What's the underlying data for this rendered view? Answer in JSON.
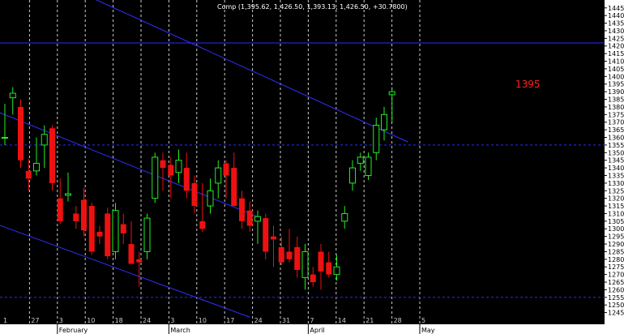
{
  "chart_data": {
    "type": "candlestick",
    "title": "Comp (1,395.62, 1,426.50, 1,393.13, 1,426.50, +30.7800)",
    "annotation": "1395",
    "ylim": [
      1240,
      1447
    ],
    "y_ticks": [
      1245,
      1250,
      1255,
      1260,
      1265,
      1270,
      1275,
      1280,
      1285,
      1290,
      1295,
      1300,
      1305,
      1310,
      1315,
      1320,
      1325,
      1330,
      1335,
      1340,
      1345,
      1350,
      1355,
      1360,
      1365,
      1370,
      1375,
      1380,
      1385,
      1390,
      1395,
      1400,
      1405,
      1410,
      1415,
      1420,
      1425,
      1430,
      1435,
      1440,
      1445
    ],
    "x_ticks": [
      "1",
      "27",
      "3",
      "10",
      "18",
      "24",
      "3",
      "10",
      "17",
      "24",
      "31",
      "7",
      "14",
      "21",
      "28",
      "5"
    ],
    "month_labels": [
      "February",
      "March",
      "April",
      "May"
    ],
    "horizontal_lines": [
      1422,
      1355,
      1255
    ],
    "trend_lines": [
      {
        "from": [
          -1,
          1480
        ],
        "to": [
          51,
          1357
        ]
      },
      {
        "from": [
          -1,
          1377
        ],
        "to": [
          32,
          1308
        ]
      },
      {
        "from": [
          -1,
          1303
        ],
        "to": [
          31,
          1242
        ]
      }
    ],
    "candles": [
      {
        "o": 1360,
        "h": 1382,
        "l": 1355,
        "c": 1360
      },
      {
        "o": 1386,
        "h": 1393,
        "l": 1375,
        "c": 1389
      },
      {
        "o": 1380,
        "h": 1385,
        "l": 1340,
        "c": 1345
      },
      {
        "o": 1338,
        "h": 1346,
        "l": 1325,
        "c": 1333
      },
      {
        "o": 1338,
        "h": 1360,
        "l": 1335,
        "c": 1343
      },
      {
        "o": 1355,
        "h": 1368,
        "l": 1340,
        "c": 1362
      },
      {
        "o": 1366,
        "h": 1368,
        "l": 1325,
        "c": 1330
      },
      {
        "o": 1320,
        "h": 1333,
        "l": 1303,
        "c": 1305
      },
      {
        "o": 1322,
        "h": 1337,
        "l": 1318,
        "c": 1323
      },
      {
        "o": 1310,
        "h": 1315,
        "l": 1300,
        "c": 1305
      },
      {
        "o": 1319,
        "h": 1327,
        "l": 1295,
        "c": 1299
      },
      {
        "o": 1315,
        "h": 1317,
        "l": 1283,
        "c": 1285
      },
      {
        "o": 1298,
        "h": 1302,
        "l": 1290,
        "c": 1295
      },
      {
        "o": 1310,
        "h": 1314,
        "l": 1280,
        "c": 1282
      },
      {
        "o": 1285,
        "h": 1317,
        "l": 1280,
        "c": 1312
      },
      {
        "o": 1303,
        "h": 1310,
        "l": 1290,
        "c": 1297
      },
      {
        "o": 1290,
        "h": 1305,
        "l": 1280,
        "c": 1277
      },
      {
        "o": 1280,
        "h": 1285,
        "l": 1262,
        "c": 1278
      },
      {
        "o": 1285,
        "h": 1310,
        "l": 1280,
        "c": 1307
      },
      {
        "o": 1320,
        "h": 1350,
        "l": 1317,
        "c": 1347
      },
      {
        "o": 1345,
        "h": 1350,
        "l": 1325,
        "c": 1340
      },
      {
        "o": 1342,
        "h": 1347,
        "l": 1320,
        "c": 1335
      },
      {
        "o": 1337,
        "h": 1352,
        "l": 1330,
        "c": 1345
      },
      {
        "o": 1340,
        "h": 1350,
        "l": 1320,
        "c": 1325
      },
      {
        "o": 1330,
        "h": 1335,
        "l": 1310,
        "c": 1315
      },
      {
        "o": 1305,
        "h": 1330,
        "l": 1298,
        "c": 1300
      },
      {
        "o": 1315,
        "h": 1333,
        "l": 1310,
        "c": 1325
      },
      {
        "o": 1330,
        "h": 1345,
        "l": 1320,
        "c": 1340
      },
      {
        "o": 1343,
        "h": 1345,
        "l": 1320,
        "c": 1335
      },
      {
        "o": 1340,
        "h": 1350,
        "l": 1315,
        "c": 1315
      },
      {
        "o": 1320,
        "h": 1325,
        "l": 1300,
        "c": 1305
      },
      {
        "o": 1312,
        "h": 1318,
        "l": 1298,
        "c": 1302
      },
      {
        "o": 1305,
        "h": 1312,
        "l": 1290,
        "c": 1308
      },
      {
        "o": 1307,
        "h": 1310,
        "l": 1280,
        "c": 1285
      },
      {
        "o": 1295,
        "h": 1302,
        "l": 1275,
        "c": 1293
      },
      {
        "o": 1288,
        "h": 1295,
        "l": 1276,
        "c": 1278
      },
      {
        "o": 1285,
        "h": 1300,
        "l": 1278,
        "c": 1280
      },
      {
        "o": 1288,
        "h": 1295,
        "l": 1268,
        "c": 1273
      },
      {
        "o": 1268,
        "h": 1290,
        "l": 1260,
        "c": 1285
      },
      {
        "o": 1270,
        "h": 1275,
        "l": 1262,
        "c": 1265
      },
      {
        "o": 1285,
        "h": 1290,
        "l": 1260,
        "c": 1272
      },
      {
        "o": 1278,
        "h": 1285,
        "l": 1268,
        "c": 1270
      },
      {
        "o": 1270,
        "h": 1283,
        "l": 1266,
        "c": 1275
      },
      {
        "o": 1305,
        "h": 1315,
        "l": 1300,
        "c": 1310
      },
      {
        "o": 1330,
        "h": 1345,
        "l": 1325,
        "c": 1340
      },
      {
        "o": 1343,
        "h": 1350,
        "l": 1338,
        "c": 1347
      },
      {
        "o": 1335,
        "h": 1350,
        "l": 1332,
        "c": 1347
      },
      {
        "o": 1350,
        "h": 1373,
        "l": 1345,
        "c": 1368
      },
      {
        "o": 1365,
        "h": 1380,
        "l": 1358,
        "c": 1375
      },
      {
        "o": 1388,
        "h": 1393,
        "l": 1370,
        "c": 1390
      }
    ]
  }
}
